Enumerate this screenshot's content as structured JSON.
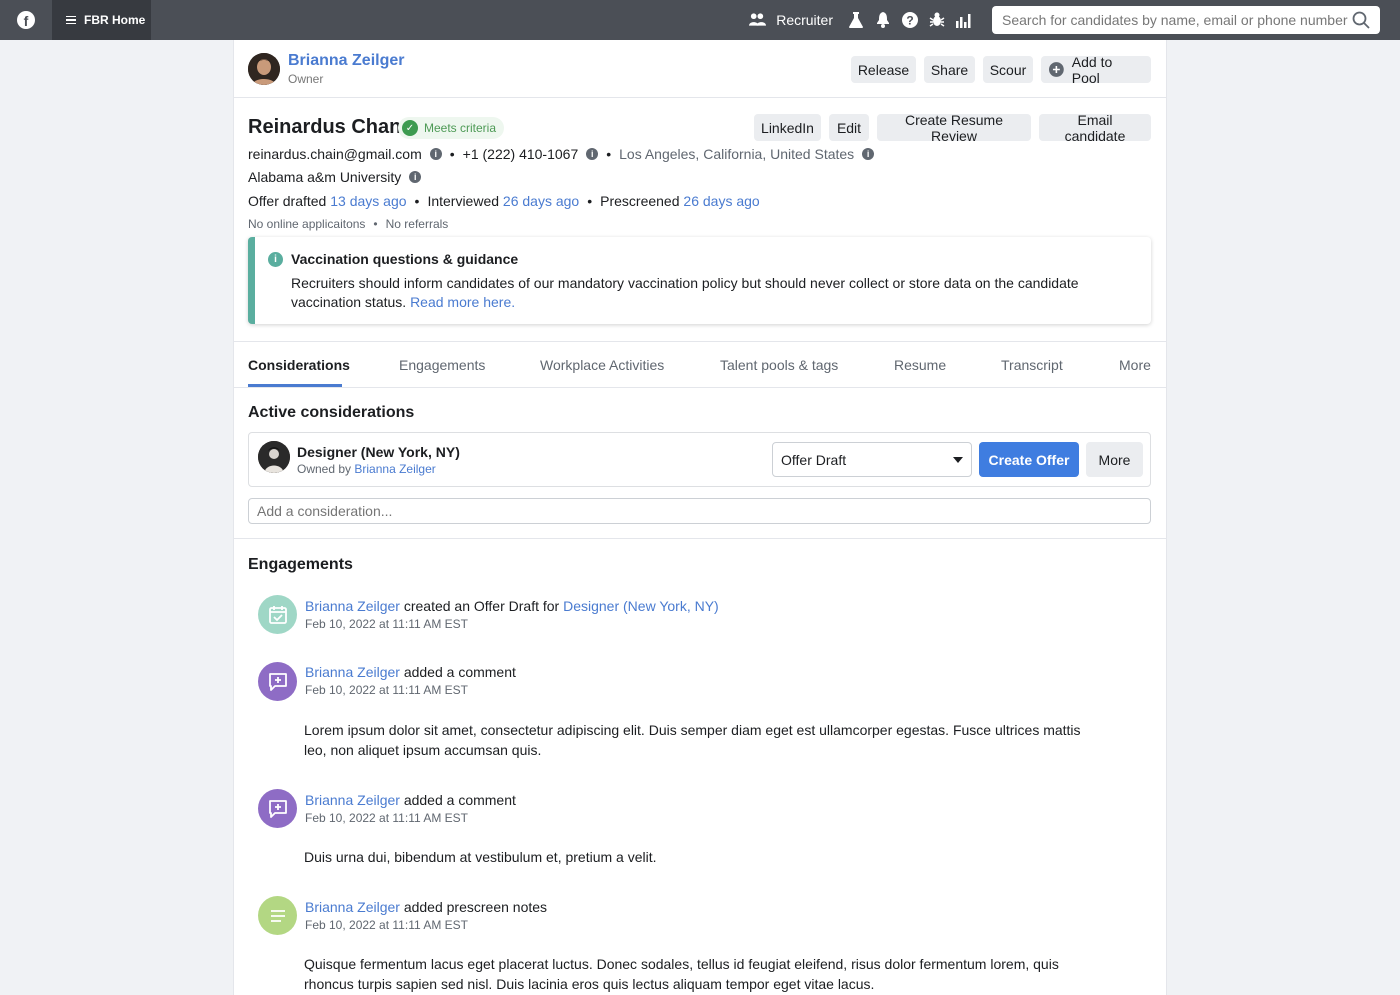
{
  "topbar": {
    "home_label": "FBR Home",
    "recruiter_label": "Recruiter",
    "search_placeholder": "Search for candidates by name, email or phone number"
  },
  "owner": {
    "name": "Brianna Zeilger",
    "role": "Owner",
    "actions": [
      "Release",
      "Share",
      "Scour",
      "Add to Pool"
    ]
  },
  "candidate": {
    "name": "Reinardus Chan",
    "badge": "Meets criteria",
    "actions": [
      "LinkedIn",
      "Edit",
      "Create Resume Review",
      "Email candidate"
    ],
    "email": "reinardus.chain@gmail.com",
    "phone": "+1 (222) 410-1067",
    "location": "Los Angeles, California, United States",
    "school": "Alabama a&m University",
    "offer_drafted_label": "Offer drafted",
    "offer_drafted_value": "13 days ago",
    "interviewed_label": "Interviewed",
    "interviewed_value": "26 days ago",
    "prescreened_label": "Prescreened",
    "prescreened_value": "26 days ago",
    "applications": "No online applicaitons",
    "referrals": "No referrals"
  },
  "notice": {
    "title": "Vaccination questions & guidance",
    "body": "Recruiters should inform candidates of our mandatory vaccination policy but should never collect or store data on the candidate vaccination status.",
    "link": "Read more here."
  },
  "tabs": [
    "Considerations",
    "Engagements",
    "Workplace Activities",
    "Talent pools & tags",
    "Resume",
    "Transcript",
    "More"
  ],
  "considerations": {
    "title": "Active considerations",
    "item": {
      "title": "Designer (New York, NY)",
      "owned_by_label": "Owned by",
      "owner": "Brianna Zeilger",
      "status": "Offer Draft",
      "primary_action": "Create Offer",
      "more": "More"
    },
    "add_placeholder": "Add a consideration..."
  },
  "engagements": {
    "title": "Engagements",
    "items": [
      {
        "actor": "Brianna Zeilger",
        "action": "created an Offer Draft for",
        "target": "Designer (New York, NY)",
        "time": "Feb 10, 2022 at 11:11 AM EST",
        "icon": "calendar-check-icon",
        "color": "#9fd7c6",
        "body": ""
      },
      {
        "actor": "Brianna Zeilger",
        "action": "added a comment",
        "target": "",
        "time": "Feb 10, 2022 at 11:11 AM EST",
        "icon": "comment-add-icon",
        "color": "#8e6cc5",
        "body": "Lorem ipsum dolor sit amet, consectetur adipiscing elit. Duis semper diam eget est ullamcorper egestas. Fusce ultrices mattis leo, non aliquet ipsum accumsan quis."
      },
      {
        "actor": "Brianna Zeilger",
        "action": "added a comment",
        "target": "",
        "time": "Feb 10, 2022 at 11:11 AM EST",
        "icon": "comment-add-icon",
        "color": "#8e6cc5",
        "body": "Duis urna dui, bibendum at vestibulum et, pretium a velit."
      },
      {
        "actor": "Brianna Zeilger",
        "action": "added prescreen notes",
        "target": "",
        "time": "Feb 10, 2022 at 11:11 AM EST",
        "icon": "notes-icon",
        "color": "#b3d783",
        "body": "Quisque fermentum lacus eget placerat luctus. Donec sodales, tellus id  feugiat eleifend, risus dolor fermentum lorem, quis rhoncus turpis  sapien sed nisl. Duis lacinia eros quis lectus aliquam tempor eget vitae  lacus."
      }
    ]
  }
}
